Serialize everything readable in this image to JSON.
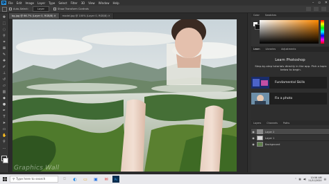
{
  "menubar": {
    "logo": "Ps",
    "items": [
      "File",
      "Edit",
      "Image",
      "Layer",
      "Type",
      "Select",
      "Filter",
      "3D",
      "View",
      "Window",
      "Help"
    ],
    "window_controls": [
      "–",
      "▫",
      "✕"
    ]
  },
  "options_bar": {
    "auto_select_label": "Auto-Select:",
    "auto_select_value": "Layer",
    "transform_label": "Show Transform Controls"
  },
  "document_tabs": [
    {
      "label": "bg.jpg @ 66.7% (Layer 0, RGB/8) ✕",
      "active": true
    },
    {
      "label": "model.jpg @ 100% (Layer 0, RGB/8) ✕",
      "active": false
    }
  ],
  "color_panel": {
    "tabs": [
      "Color",
      "Swatches"
    ]
  },
  "learn_panel": {
    "tabs": [
      "Learn",
      "Libraries",
      "Adjustments"
    ],
    "title": "Learn Photoshop",
    "description": "Step-by-step tutorials directly in the app. Pick a topic below to begin.",
    "cards": [
      {
        "label": "Fundamental Skills"
      },
      {
        "label": "Fix a photo"
      }
    ]
  },
  "layers_panel": {
    "tabs": [
      "Layers",
      "Channels",
      "Paths"
    ],
    "layers": [
      {
        "name": "Layer 2",
        "selected": true
      },
      {
        "name": "Layer 1",
        "selected": false
      },
      {
        "name": "Background",
        "selected": false
      }
    ]
  },
  "taskbar": {
    "search_placeholder": "Type here to search",
    "time": "10:56 AM",
    "date": "11/11/2020"
  },
  "watermark": "Graphics Wall"
}
